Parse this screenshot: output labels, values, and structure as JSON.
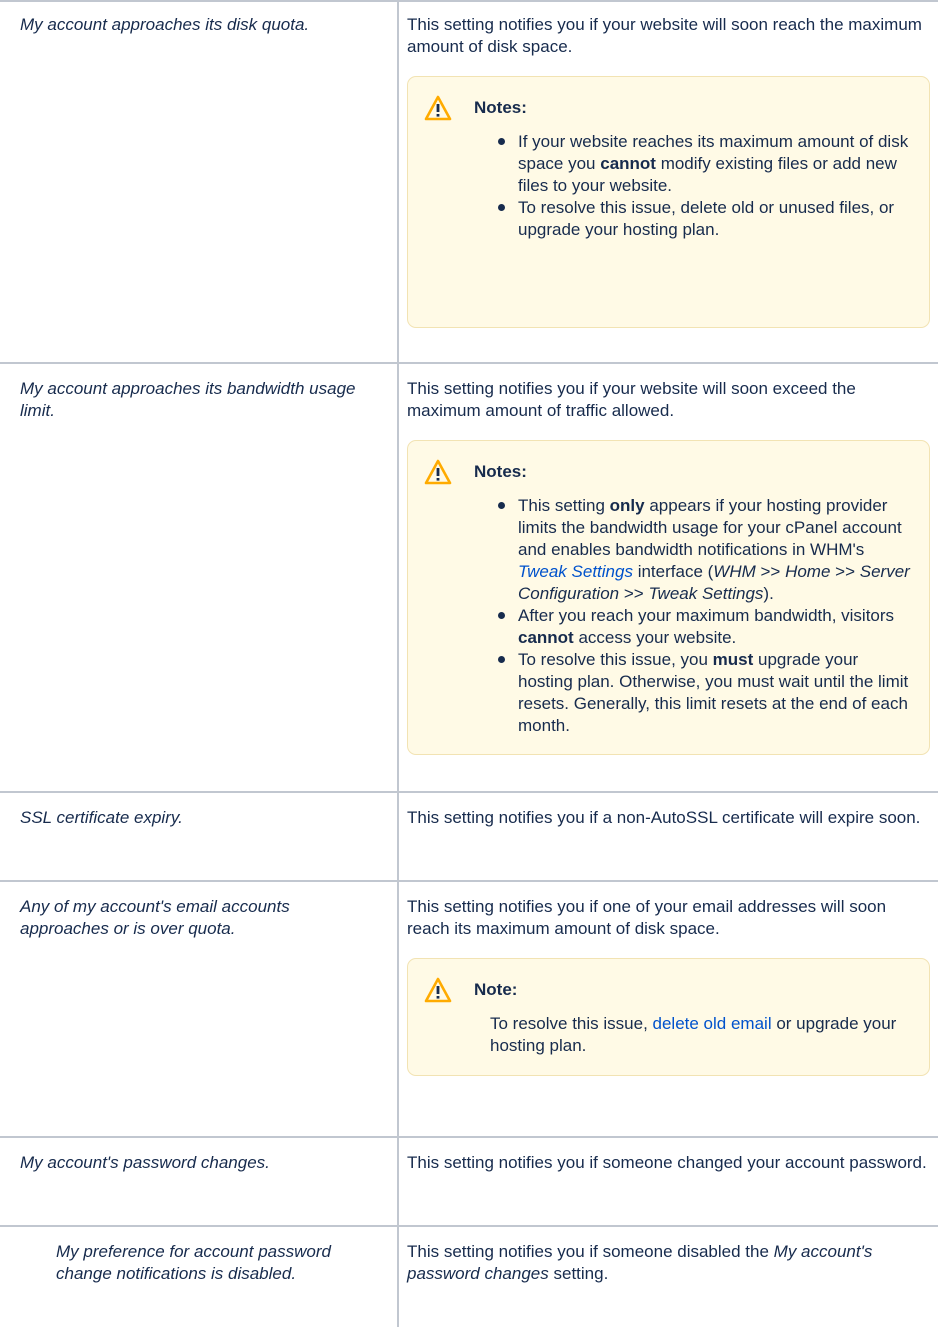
{
  "rows": [
    {
      "setting": "My account approaches its disk quota.",
      "description": "This setting notifies you if your website will soon reach the maximum amount of disk space.",
      "note": {
        "title": "Notes:",
        "items": [
          {
            "a": "If your website reaches its maximum amount of disk space you ",
            "b": "cannot",
            "c": " modify existing files or add new files to your website."
          },
          {
            "a": "To resolve this issue, delete old or unused files, or upgrade your hosting plan."
          }
        ]
      }
    },
    {
      "setting": "My account approaches its bandwidth usage limit.",
      "description": "This setting notifies you if your website will soon exceed the maximum amount of traffic allowed.",
      "note": {
        "title": "Notes:",
        "items": [
          {
            "a": "This setting ",
            "b": "only",
            "c": " appears if your hosting provider limits the bandwidth usage for your cPanel account and enables bandwidth notifications in WHM's ",
            "link": "Tweak Settings",
            "d": " interface (",
            "e1": "WHM",
            "e2": " >> ",
            "e3": "Home",
            "e4": " >> ",
            "e5": "Server Configuration",
            "e6": " >> ",
            "e7": "Tweak Settings",
            "f": ")."
          },
          {
            "a": "After you reach your maximum bandwidth, visitors ",
            "b": "cannot",
            "c": " access your website."
          },
          {
            "a": "To resolve this issue, you ",
            "b": "must",
            "c": " upgrade your hosting plan. Otherwise, you must wait until the limit resets. Generally, this limit resets at the end of each month."
          }
        ]
      }
    },
    {
      "setting": "SSL certificate expiry.",
      "description": "This setting notifies you if a non-AutoSSL certificate will expire soon."
    },
    {
      "setting": "Any of my account's email accounts approaches or is over quota.",
      "description": "This setting notifies you if one of your email addresses will soon reach its maximum amount of disk space.",
      "note": {
        "title": "Note:",
        "text_a": "To resolve this issue, ",
        "link": "delete old email",
        "text_b": " or upgrade your hosting plan."
      }
    },
    {
      "setting": "My account's password changes.",
      "description": "This setting notifies you if someone changed your account password."
    },
    {
      "setting": "My preference for account password change notifications is disabled.",
      "description_a": "This setting notifies you if someone disabled the ",
      "description_it": "My account's password changes",
      "description_b": " setting."
    }
  ],
  "icon": "warning-icon",
  "colors": {
    "note_bg": "#fffae6",
    "link": "#0052cc",
    "warning": "#ffab00"
  }
}
